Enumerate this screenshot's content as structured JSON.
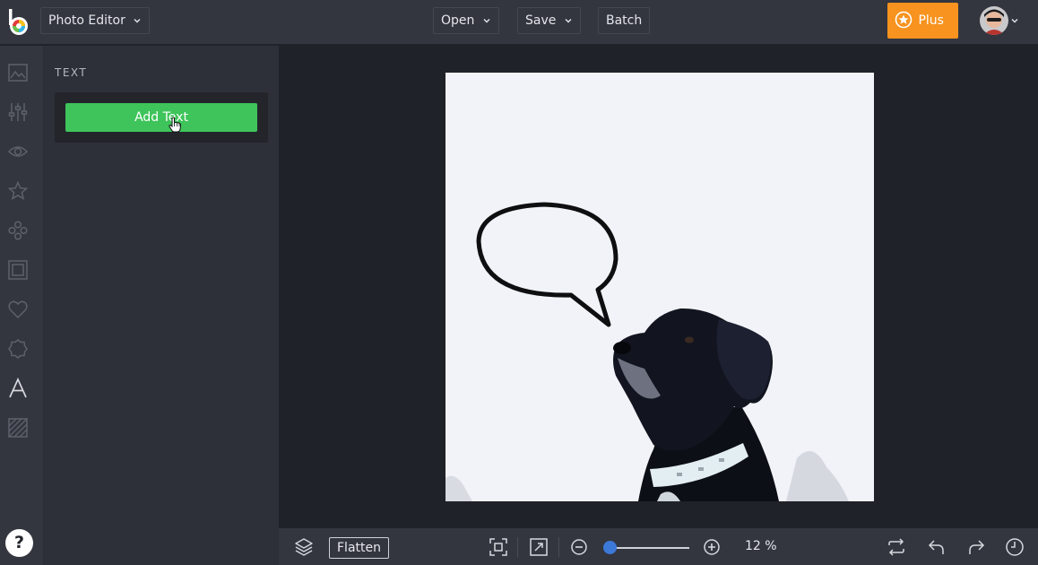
{
  "header": {
    "app_menu_label": "Photo Editor",
    "open_label": "Open",
    "save_label": "Save",
    "batch_label": "Batch",
    "plus_label": "Plus"
  },
  "sidebar": {
    "items": [
      {
        "name": "edit",
        "icon": "image-icon"
      },
      {
        "name": "adjust",
        "icon": "sliders-icon"
      },
      {
        "name": "effects",
        "icon": "eye-icon"
      },
      {
        "name": "overlays",
        "icon": "star-icon"
      },
      {
        "name": "filters",
        "icon": "circles-icon"
      },
      {
        "name": "frames",
        "icon": "frame-icon"
      },
      {
        "name": "graphics",
        "icon": "heart-icon"
      },
      {
        "name": "stickers",
        "icon": "badge-icon"
      },
      {
        "name": "text",
        "icon": "text-icon",
        "active": true
      },
      {
        "name": "textures",
        "icon": "texture-icon"
      }
    ],
    "help_label": "?"
  },
  "panel": {
    "title": "TEXT",
    "add_text_label": "Add Text"
  },
  "bottom": {
    "flatten_label": "Flatten",
    "zoom_label": "12 %",
    "zoom_fraction": 0.0
  },
  "colors": {
    "accent_green": "#3ec45a",
    "plus_orange": "#f7931e",
    "slider_blue": "#3b78d8"
  }
}
